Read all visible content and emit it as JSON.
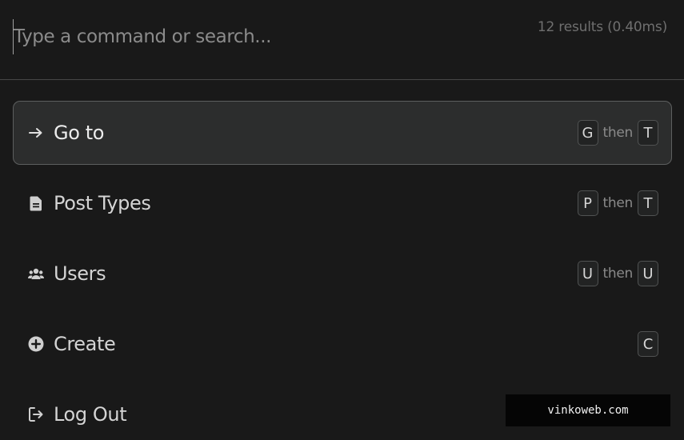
{
  "search": {
    "placeholder": "Type a command or search...",
    "value": "",
    "results": "12 results (0.40ms)"
  },
  "items": [
    {
      "label": "Go to",
      "icon": "arrow-right-icon",
      "keys": [
        "G",
        "T"
      ],
      "connector": "then",
      "active": true
    },
    {
      "label": "Post Types",
      "icon": "document-icon",
      "keys": [
        "P",
        "T"
      ],
      "connector": "then",
      "active": false
    },
    {
      "label": "Users",
      "icon": "users-icon",
      "keys": [
        "U",
        "U"
      ],
      "connector": "then",
      "active": false
    },
    {
      "label": "Create",
      "icon": "plus-circle-icon",
      "keys": [
        "C"
      ],
      "active": false
    },
    {
      "label": "Log Out",
      "icon": "logout-icon",
      "keys": [],
      "active": false
    }
  ],
  "watermark": "vinkoweb.com",
  "colors": {
    "background": "#191919",
    "active_item": "#2c2d2d",
    "active_border": "#5d5f5f",
    "divider": "#474747"
  }
}
